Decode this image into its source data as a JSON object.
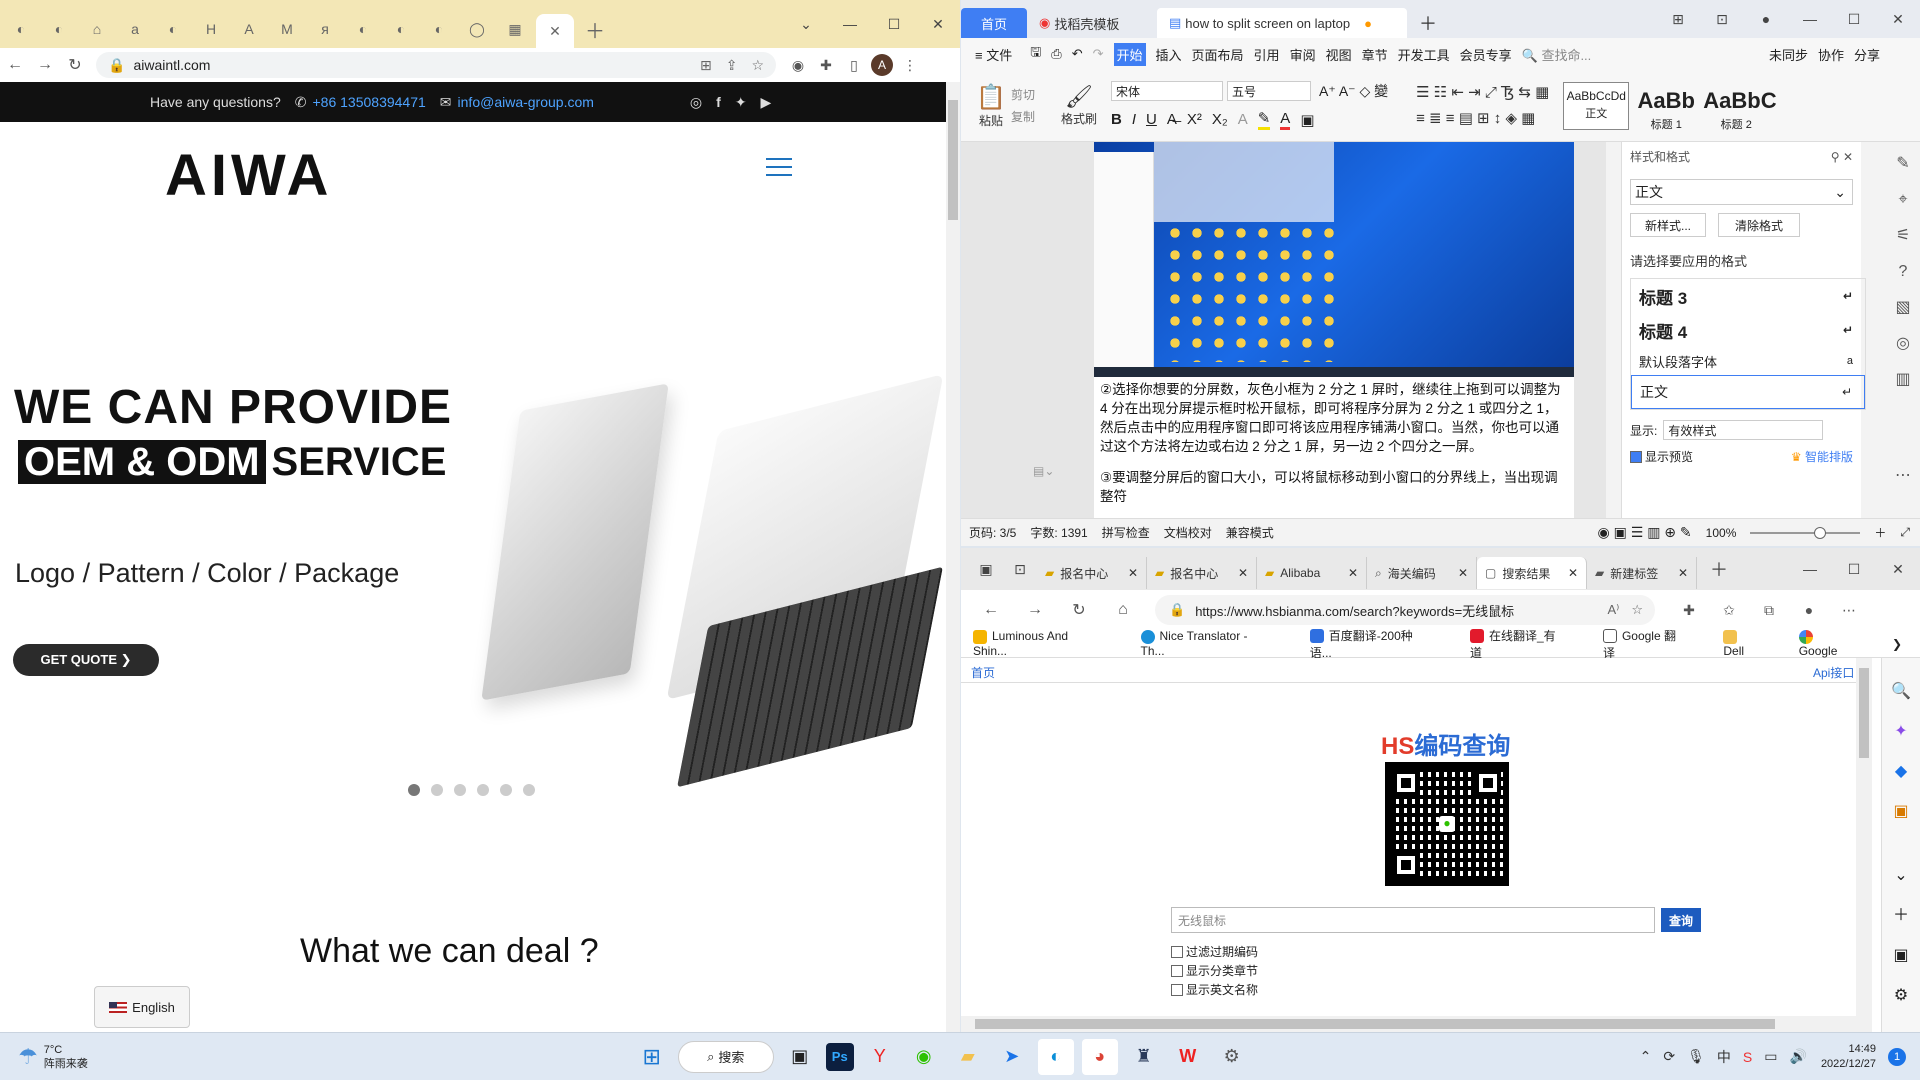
{
  "chrome": {
    "url": "aiwaintl.com",
    "avatar_letter": "A",
    "tab_favicons": [
      "◐",
      "◐",
      "⌂",
      "a",
      "◐",
      "H",
      "A",
      "M",
      "я",
      "◐",
      "◐",
      "◐",
      "◯",
      "▦",
      "✕"
    ],
    "site": {
      "question": "Have any questions?",
      "phone": "+86 13508394471",
      "email": "info@aiwa-group.com",
      "logo": "AIWA",
      "hero_line1": "WE CAN PROVIDE",
      "hero_inv": "OEM & ODM",
      "hero_rest": "SERVICE",
      "hero_sub": "Logo / Pattern / Color / Package",
      "quote_btn": "GET QUOTE ❯",
      "deal_heading": "What we can deal ?",
      "language": "English"
    }
  },
  "wps": {
    "tabs": [
      "首页",
      "找稻壳模板",
      "how to split screen on laptop"
    ],
    "menu": [
      "≡ 文件",
      "开始",
      "插入",
      "页面布局",
      "引用",
      "审阅",
      "视图",
      "章节",
      "开发工具",
      "会员专享",
      "🔍 查找命..."
    ],
    "menu_right": [
      "未同步",
      "协作",
      "分享"
    ],
    "clipboard": [
      "粘贴",
      "剪切",
      "复制",
      "格式刷"
    ],
    "font_name": "宋体",
    "font_size": "五号",
    "styles": [
      {
        "sample": "AaBbCcDd",
        "name": "正文"
      },
      {
        "sample": "AaBb",
        "name": "标题 1"
      },
      {
        "sample": "AaBbC",
        "name": "标题 2"
      }
    ],
    "doc_text": "②选择你想要的分屏数，灰色小框为 2 分之 1 屏时，继续往上拖到可以调整为 4 分在出现分屏提示框时松开鼠标，即可将程序分屏为 2 分之 1 或四分之 1，然后点击中的应用程序窗口即可将该应用程序铺满小窗口。当然，你也可以通过这个方法将左边或右边 2 分之 1 屏，另一边 2 个四分之一屏。",
    "doc_text2": "③要调整分屏后的窗口大小，可以将鼠标移动到小窗口的分界线上，当出现调整符",
    "side": {
      "title": "样式和格式",
      "current": "正文",
      "new_style": "新样式...",
      "clear": "清除格式",
      "prompt": "请选择要应用的格式",
      "items": [
        "标题 3",
        "标题 4",
        "默认段落字体",
        "正文"
      ],
      "show_label": "显示:",
      "show_value": "有效样式",
      "preview": "显示预览",
      "smart": "智能排版"
    },
    "status": {
      "page": "页码: 3/5",
      "words": "字数: 1391",
      "spell": "拼写检查",
      "proof": "文档校对",
      "compat": "兼容模式",
      "zoom": "100%"
    }
  },
  "edge": {
    "tabs": [
      "报名中心",
      "报名中心",
      "Alibaba",
      "海关编码",
      "搜索结果",
      "新建标签"
    ],
    "url": "https://www.hsbianma.com/search?keywords=无线鼠标",
    "bookmarks": [
      "Luminous And Shin...",
      "Nice Translator - Th...",
      "百度翻译-200种语...",
      "在线翻译_有道",
      "Google 翻译",
      "Dell",
      "Google"
    ],
    "home_link": "首页",
    "api_link": "Api接口",
    "logo_red": "HS",
    "logo_blue": "编码查询",
    "search_value": "无线鼠标",
    "search_btn": "查询",
    "checks": [
      "过滤过期编码",
      "显示分类章节",
      "显示英文名称"
    ]
  },
  "taskbar": {
    "weather_temp": "7°C",
    "weather_desc": "阵雨来袭",
    "search": "搜索",
    "time": "14:49",
    "date": "2022/12/27",
    "badge": "1"
  }
}
